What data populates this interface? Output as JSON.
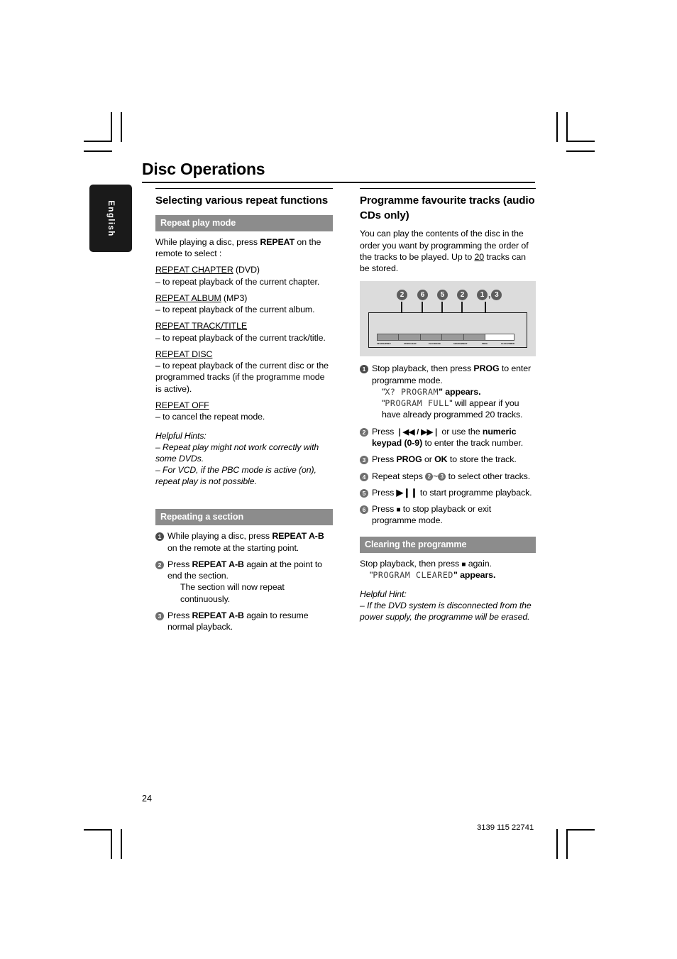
{
  "document": {
    "chapter_title": "Disc Operations",
    "language_tab": "English",
    "page_number": "24",
    "doc_code": "3139 115 22741"
  },
  "left_column": {
    "section_title": "Selecting various repeat functions",
    "repeat_play_mode": {
      "heading": "Repeat play mode",
      "intro_a": "While playing a disc, press ",
      "intro_bold": "REPEAT",
      "intro_b": " on the remote to select :",
      "modes": [
        {
          "name": "REPEAT CHAPTER",
          "qualifier": " (DVD)",
          "desc": "–  to repeat playback of the current chapter."
        },
        {
          "name": "REPEAT ALBUM",
          "qualifier": " (MP3)",
          "desc": "–  to repeat playback of the current album."
        },
        {
          "name": "REPEAT TRACK/TITLE",
          "qualifier": "",
          "desc": "–  to repeat playback of the current track/title."
        },
        {
          "name": "REPEAT DISC",
          "qualifier": "",
          "desc": "–  to repeat playback of the current disc or the programmed tracks (if the programme mode is active)."
        },
        {
          "name": "REPEAT OFF",
          "qualifier": "",
          "desc": "–  to cancel the repeat mode."
        }
      ],
      "hints_title": "Helpful Hints:",
      "hints": [
        "–  Repeat play might not work correctly with some DVDs.",
        "–  For VCD, if the PBC mode is active (on), repeat play is not possible."
      ]
    },
    "repeating_section": {
      "heading": "Repeating a section",
      "steps": [
        {
          "num": "1",
          "pre": "While playing a disc, press ",
          "bold": "REPEAT A-B",
          "post": " on the remote at the starting point.",
          "extra": ""
        },
        {
          "num": "2",
          "pre": "Press ",
          "bold": "REPEAT A-B",
          "post": " again at the point to end the section.",
          "extra": "The section will now repeat continuously."
        },
        {
          "num": "3",
          "pre": "Press ",
          "bold": "REPEAT A-B",
          "post": " again to resume normal playback.",
          "extra": ""
        }
      ]
    }
  },
  "right_column": {
    "section_title": "Programme favourite tracks (audio CDs only)",
    "intro_a": "You can play the contents of the disc in the order you want by programming the order of the tracks to be played. Up to ",
    "intro_underlined": "20",
    "intro_b": " tracks can be stored.",
    "illustration": {
      "callouts": [
        "2",
        "6",
        "5",
        "2",
        "1",
        "3"
      ],
      "button_labels": [
        "SEARCH/PREV",
        "STOP/CLEAR",
        "PLAY/PAUSE",
        "SEARCH/NEXT",
        "PROG",
        "CLOCK/TIMER"
      ]
    },
    "programme_steps": [
      {
        "num": "1",
        "pre": "Stop playback, then press ",
        "bold": "PROG",
        "post": " to enter programme mode.",
        "lcd1_quote_open": "\"",
        "lcd1": "X? PROGRAM",
        "lcd1_after": "\" appears.",
        "lcd2": "PROGRAM FULL",
        "lcd2_after": "\" will appear if you have already programmed 20 tracks."
      },
      {
        "num": "2",
        "pre": "Press ",
        "symbols": "❘◀◀ /  ▶▶❘",
        "mid": " or use the ",
        "bold": "numeric keypad (0-9)",
        "post": " to enter the track number."
      },
      {
        "num": "3",
        "pre": "Press ",
        "bold": "PROG",
        "mid": " or ",
        "bold2": "OK",
        "post": " to store the track."
      },
      {
        "num": "4",
        "pre": "Repeat steps ",
        "inline_nums": [
          "2",
          "3"
        ],
        "post": " to select other tracks."
      },
      {
        "num": "5",
        "pre": "Press ",
        "symbols": "▶❙❙",
        "post": " to start programme playback."
      },
      {
        "num": "6",
        "pre": "Press ",
        "symbols": "■",
        "post": " to stop playback or exit programme mode."
      }
    ],
    "clearing": {
      "heading": "Clearing the programme",
      "line_pre": "Stop playback, then press ",
      "line_symbol": "■",
      "line_post": " again.",
      "lcd": "PROGRAM CLEARED",
      "lcd_after": "\" appears.",
      "hint_title": "Helpful Hint:",
      "hint": "–  If the DVD system is disconnected from the power supply, the programme will be erased."
    }
  }
}
